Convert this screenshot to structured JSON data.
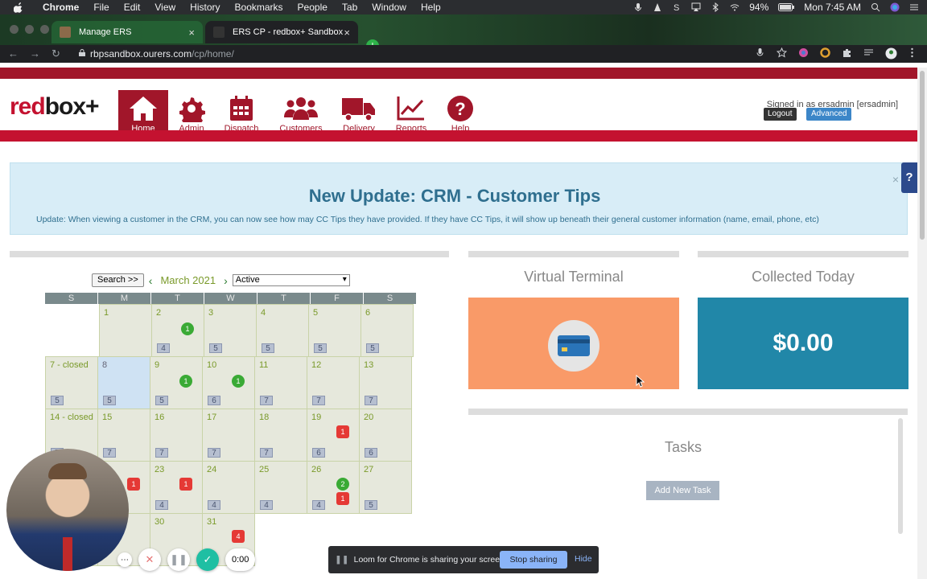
{
  "menubar": {
    "app": "Chrome",
    "items": [
      "File",
      "Edit",
      "View",
      "History",
      "Bookmarks",
      "People",
      "Tab",
      "Window",
      "Help"
    ],
    "battery": "94%",
    "clock": "Mon 7:45 AM"
  },
  "tabs": [
    {
      "title": "Manage ERS"
    },
    {
      "title": "ERS CP - redbox+ Sandbox"
    }
  ],
  "address": {
    "host": "rbpsandbox.ourers.com",
    "path": "/cp/home/"
  },
  "site": {
    "logo_red": "red",
    "logo_box": "box",
    "logo_plus": "+",
    "nav": [
      {
        "label": "Home",
        "icon": "home-icon"
      },
      {
        "label": "Admin",
        "icon": "gear-icon"
      },
      {
        "label": "Dispatch",
        "icon": "calendar-icon"
      },
      {
        "label": "Customers",
        "icon": "users-icon"
      },
      {
        "label": "Delivery",
        "icon": "truck-icon"
      },
      {
        "label": "Reports",
        "icon": "chart-line-icon"
      },
      {
        "label": "Help",
        "icon": "question-icon"
      }
    ],
    "signed_in": "Signed in as ersadmin [ersadmin]",
    "logout": "Logout",
    "advanced": "Advanced"
  },
  "alert": {
    "title": "New Update: CRM - Customer Tips",
    "body": "Update:  When viewing a customer in the CRM, you can now see how may CC Tips they have provided.  If they have CC Tips, it will show up beneath their general customer information (name, email, phone, etc)",
    "close": "×"
  },
  "help_tab": "?",
  "calendar": {
    "search_label": "Search >>",
    "month": "March 2021",
    "filter": "Active",
    "weekdays": [
      "S",
      "M",
      "T",
      "W",
      "T",
      "F",
      "S"
    ],
    "days": {
      "d1": "1",
      "d2": "2",
      "d3": "3",
      "d4": "4",
      "d5": "5",
      "d6": "6",
      "d7": "7 - closed",
      "d8": "8",
      "d9": "9",
      "d10": "10",
      "d11": "11",
      "d12": "12",
      "d13": "13",
      "d14": "14 - closed",
      "d15": "15",
      "d16": "16",
      "d17": "17",
      "d18": "18",
      "d19": "19",
      "d20": "20",
      "d23": "23",
      "d24": "24",
      "d25": "25",
      "d26": "26",
      "d27": "27",
      "d30": "30",
      "d31": "31"
    },
    "counts": {
      "c2": "4",
      "c3": "5",
      "c4": "5",
      "c5": "5",
      "c6": "5",
      "c7": "5",
      "c8": "5",
      "c9": "5",
      "c10": "6",
      "c11": "7",
      "c12": "7",
      "c13": "7",
      "c14": "7",
      "c15": "7",
      "c16": "7",
      "c17": "7",
      "c18": "7",
      "c19": "6",
      "c20": "6",
      "c23": "4",
      "c24": "4",
      "c25": "4",
      "c26": "4",
      "c27": "5"
    },
    "badges": {
      "b2": "1",
      "b9": "1",
      "b10": "1",
      "b19": "1",
      "b22": "1",
      "b23": "1",
      "b26g": "2",
      "b26r": "1",
      "b31": "4"
    }
  },
  "virtual_terminal": {
    "title": "Virtual Terminal"
  },
  "collected_today": {
    "title": "Collected Today",
    "amount": "$0.00"
  },
  "tasks": {
    "title": "Tasks",
    "add": "Add New Task"
  },
  "loom": {
    "timer": "0:00",
    "share_text": "Loom for Chrome is sharing your screen.",
    "stop": "Stop sharing",
    "hide": "Hide"
  },
  "colors": {
    "brand_red": "#a1162a",
    "vt_orange": "#f99a68",
    "collected_teal": "#2187a8",
    "alert_bg": "#d8edf7"
  }
}
